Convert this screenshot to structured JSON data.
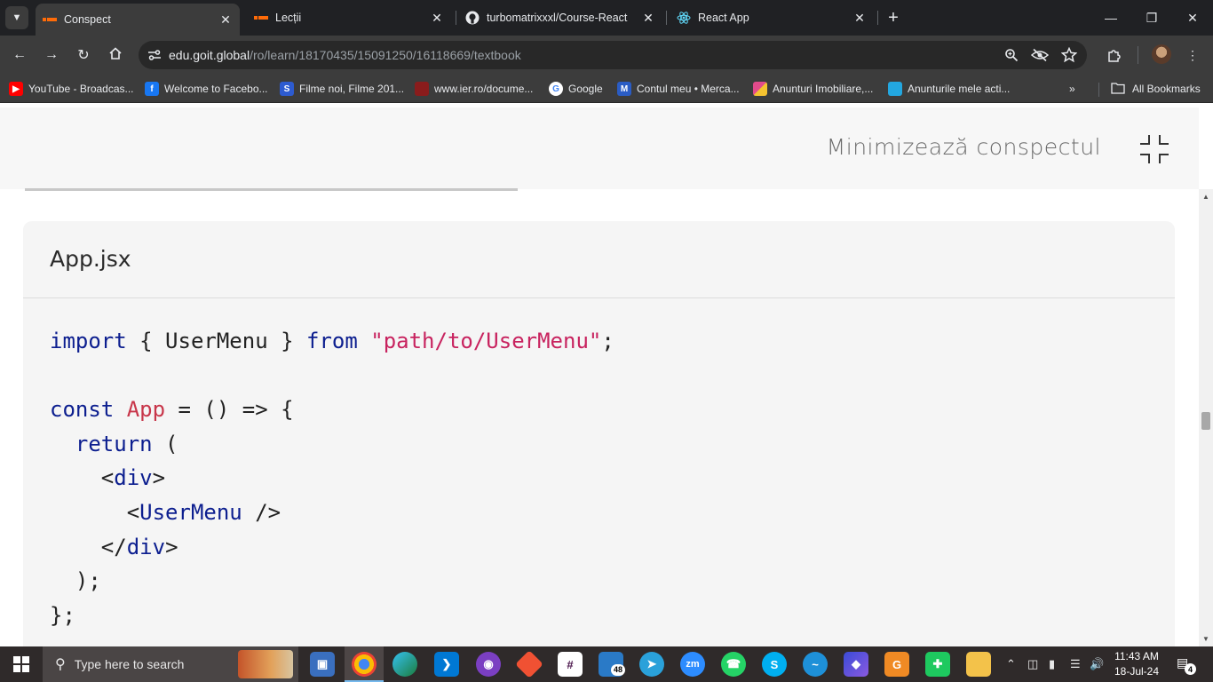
{
  "browser": {
    "tabs": [
      {
        "title": "Conspect",
        "icon": "goit-icon",
        "active": true
      },
      {
        "title": "Lecții",
        "icon": "goit-icon",
        "active": false
      },
      {
        "title": "turbomatrixxxl/Course-React",
        "icon": "github-icon",
        "active": false
      },
      {
        "title": "React App",
        "icon": "react-icon",
        "active": false
      }
    ],
    "url_host": "edu.goit.global",
    "url_path": "/ro/learn/18170435/15091250/16118669/textbook",
    "bookmarks": [
      {
        "label": "YouTube - Broadcas...",
        "icon": "youtube-icon",
        "color": "#ff0000"
      },
      {
        "label": "Welcome to Facebo...",
        "icon": "facebook-icon",
        "color": "#1877f2"
      },
      {
        "label": "Filme noi, Filme 201...",
        "icon": "filme-icon",
        "color": "#2d5bd0"
      },
      {
        "label": "www.ier.ro/docume...",
        "icon": "ier-icon",
        "color": "#8a1c1c"
      },
      {
        "label": "Google",
        "icon": "google-icon",
        "color": "#ffffff"
      },
      {
        "label": "Contul meu • Merca...",
        "icon": "mercadopago-icon",
        "color": "#2a5cc4"
      },
      {
        "label": "Anunturi Imobiliare,...",
        "icon": "imobiliare-icon",
        "color": "#e24b8c"
      },
      {
        "label": "Anunturile mele acti...",
        "icon": "olx-icon",
        "color": "#23a7e0"
      }
    ],
    "all_bookmarks": "All Bookmarks"
  },
  "page": {
    "minimize_label": "Minimizează conspectul",
    "code_title": "App.jsx"
  },
  "taskbar": {
    "search_placeholder": "Type here to search",
    "time": "11:43 AM",
    "date": "18-Jul-24",
    "notifications": "4",
    "app_badge": "48"
  }
}
